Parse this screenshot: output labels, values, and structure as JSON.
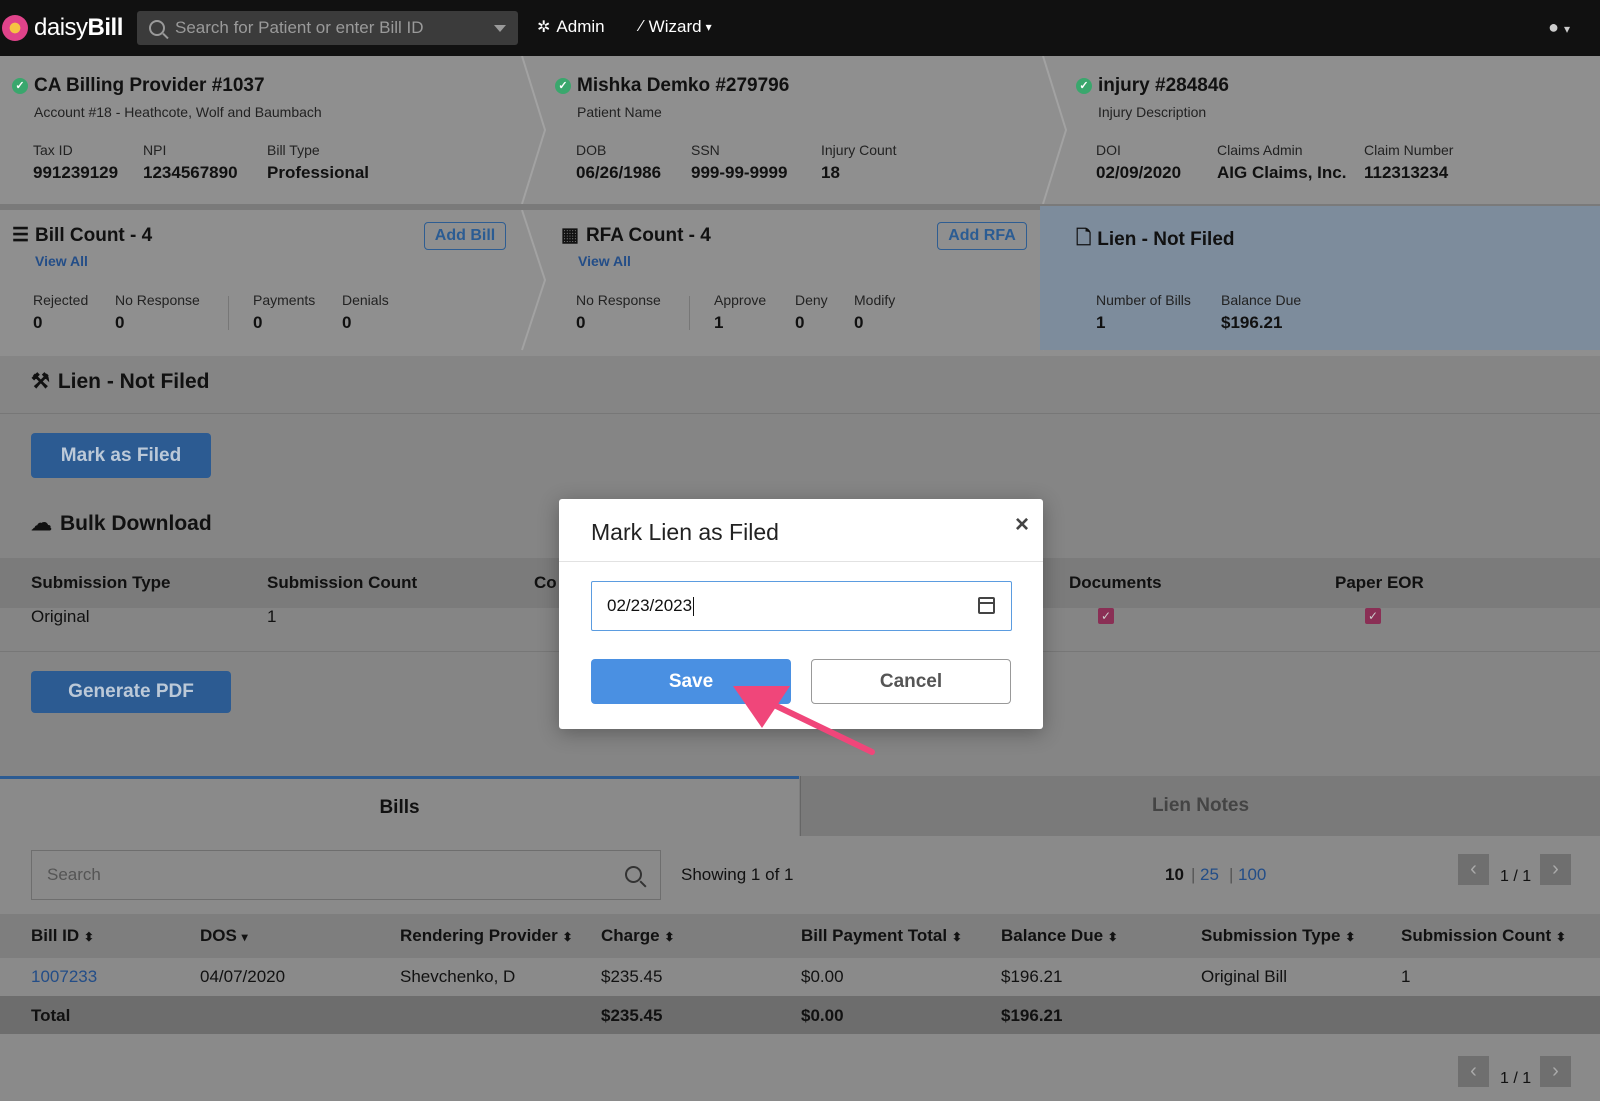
{
  "header": {
    "brand_light": "daisy",
    "brand_bold": "Bill",
    "search_placeholder": "Search for Patient or enter Bill ID",
    "admin_label": "Admin",
    "wizard_label": "Wizard",
    "icons": {
      "search": "search-icon",
      "admin": "gear-icon",
      "wizard": "wand-icon",
      "user": "user-circle-icon"
    }
  },
  "provider": {
    "title": "CA Billing Provider #1037",
    "subtitle": "Account #18 - Heathcote, Wolf and Baumbach",
    "fields": [
      {
        "label": "Tax ID",
        "value": "991239129"
      },
      {
        "label": "NPI",
        "value": "1234567890"
      },
      {
        "label": "Bill Type",
        "value": "Professional"
      }
    ]
  },
  "patient": {
    "title": "Mishka Demko #279796",
    "subtitle": "Patient Name",
    "fields": [
      {
        "label": "DOB",
        "value": "06/26/1986"
      },
      {
        "label": "SSN",
        "value": "999-99-9999"
      },
      {
        "label": "Injury Count",
        "value": "18"
      }
    ]
  },
  "injury": {
    "title": "injury #284846",
    "subtitle": "Injury Description",
    "fields": [
      {
        "label": "DOI",
        "value": "02/09/2020"
      },
      {
        "label": "Claims Admin",
        "value": "AIG Claims, Inc."
      },
      {
        "label": "Claim Number",
        "value": "112313234"
      }
    ]
  },
  "bills_card": {
    "title": "Bill Count - 4",
    "view_all": "View All",
    "add_label": "Add Bill",
    "fields": [
      {
        "label": "Rejected",
        "value": "0"
      },
      {
        "label": "No Response",
        "value": "0"
      },
      {
        "label": "Payments",
        "value": "0"
      },
      {
        "label": "Denials",
        "value": "0"
      }
    ]
  },
  "rfa_card": {
    "title": "RFA Count - 4",
    "view_all": "View All",
    "add_label": "Add RFA",
    "fields": [
      {
        "label": "No Response",
        "value": "0"
      },
      {
        "label": "Approve",
        "value": "1"
      },
      {
        "label": "Deny",
        "value": "0"
      },
      {
        "label": "Modify",
        "value": "0"
      }
    ]
  },
  "lien_card": {
    "title": "Lien - Not Filed",
    "fields": [
      {
        "label": "Number of Bills",
        "value": "1"
      },
      {
        "label": "Balance Due",
        "value": "$196.21"
      }
    ]
  },
  "lien_section": {
    "title": "Lien - Not Filed",
    "mark_filed_label": "Mark as Filed"
  },
  "bulk": {
    "title": "Bulk Download",
    "columns": [
      "Submission Type",
      "Submission Count",
      "Co",
      "Documents",
      "Paper EOR"
    ],
    "row": {
      "type": "Original",
      "count": "1"
    },
    "generate_label": "Generate PDF"
  },
  "tabs": [
    {
      "label": "Bills",
      "active": true
    },
    {
      "label": "Lien Notes",
      "active": false
    }
  ],
  "bills_table": {
    "search_placeholder": "Search",
    "showing": "Showing 1 of 1",
    "page_sizes": [
      "10",
      "25",
      "100"
    ],
    "page_info": "1 / 1",
    "columns": [
      "Bill ID",
      "DOS",
      "Rendering Provider",
      "Charge",
      "Bill Payment Total",
      "Balance Due",
      "Submission Type",
      "Submission Count"
    ],
    "rows": [
      [
        "1007233",
        "04/07/2020",
        "Shevchenko, D",
        "$235.45",
        "$0.00",
        "$196.21",
        "Original Bill",
        "1"
      ]
    ],
    "total": {
      "label": "Total",
      "charge": "$235.45",
      "payment": "$0.00",
      "balance": "$196.21"
    }
  },
  "modal": {
    "title": "Mark Lien as Filed",
    "date_value": "02/23/2023",
    "save_label": "Save",
    "cancel_label": "Cancel"
  },
  "colors": {
    "accent": "#4a90e2",
    "arrow": "#f0467a"
  }
}
